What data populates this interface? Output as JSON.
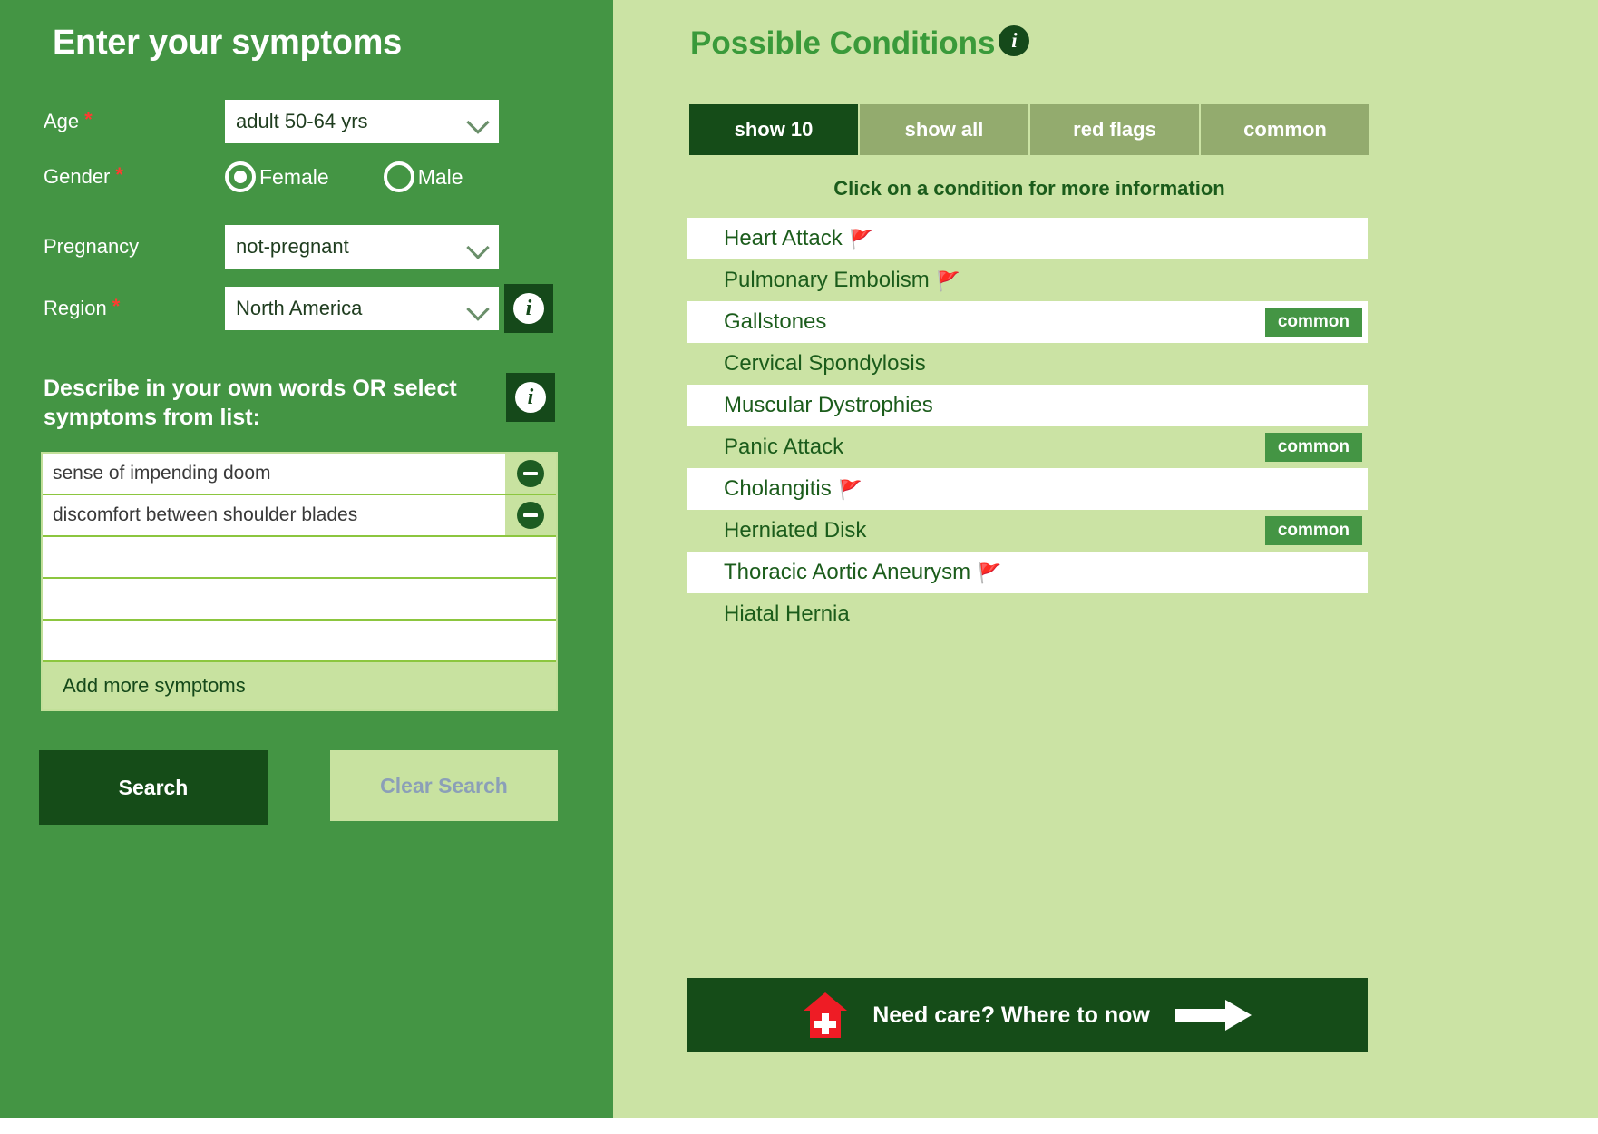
{
  "form": {
    "title": "Enter your symptoms",
    "age": {
      "label": "Age",
      "required": true,
      "value": "adult 50-64 yrs"
    },
    "gender": {
      "label": "Gender",
      "required": true,
      "options": [
        {
          "label": "Female",
          "selected": true
        },
        {
          "label": "Male",
          "selected": false
        }
      ]
    },
    "pregnancy": {
      "label": "Pregnancy",
      "required": false,
      "value": "not-pregnant"
    },
    "region": {
      "label": "Region",
      "required": true,
      "value": "North America",
      "info_icon": "info-icon"
    },
    "describe_label": "Describe in your own words OR select symptoms from list:",
    "describe_info_icon": "info-icon",
    "symptoms": [
      {
        "text": "sense of impending doom",
        "removable": true
      },
      {
        "text": "discomfort between shoulder blades",
        "removable": true
      },
      {
        "text": "",
        "removable": false
      },
      {
        "text": "",
        "removable": false
      },
      {
        "text": "",
        "removable": false
      }
    ],
    "add_more_label": "Add more symptoms",
    "search_label": "Search",
    "clear_label": "Clear Search"
  },
  "results": {
    "title": "Possible Conditions",
    "title_info_icon": "info-icon",
    "tabs": [
      {
        "label": "show 10",
        "active": true
      },
      {
        "label": "show all",
        "active": false
      },
      {
        "label": "red flags",
        "active": false
      },
      {
        "label": "common",
        "active": false
      }
    ],
    "hint": "Click on a condition for more information",
    "conditions": [
      {
        "name": "Heart Attack",
        "red_flag": true,
        "common": false
      },
      {
        "name": "Pulmonary Embolism",
        "red_flag": true,
        "common": false
      },
      {
        "name": "Gallstones",
        "red_flag": false,
        "common": true
      },
      {
        "name": "Cervical Spondylosis",
        "red_flag": false,
        "common": false
      },
      {
        "name": "Muscular Dystrophies",
        "red_flag": false,
        "common": false
      },
      {
        "name": "Panic Attack",
        "red_flag": false,
        "common": true
      },
      {
        "name": "Cholangitis",
        "red_flag": true,
        "common": false
      },
      {
        "name": "Herniated Disk",
        "red_flag": false,
        "common": true
      },
      {
        "name": "Thoracic Aortic Aneurysm",
        "red_flag": true,
        "common": false
      },
      {
        "name": "Hiatal Hernia",
        "red_flag": false,
        "common": false
      }
    ],
    "common_badge_label": "common",
    "red_flag_glyph": "🚩",
    "need_care": {
      "text": "Need care?  Where to now",
      "house_icon": "hospital-house-icon",
      "arrow_icon": "right-arrow-icon"
    }
  },
  "colors": {
    "panel_green": "#449544",
    "light_green": "#cbe3a4",
    "dark_green": "#154c18",
    "tab_inactive": "#93ab6e",
    "accent_title": "#3a9a3a",
    "required_star": "#ff3b30",
    "red_flag": "#ee1c25"
  }
}
